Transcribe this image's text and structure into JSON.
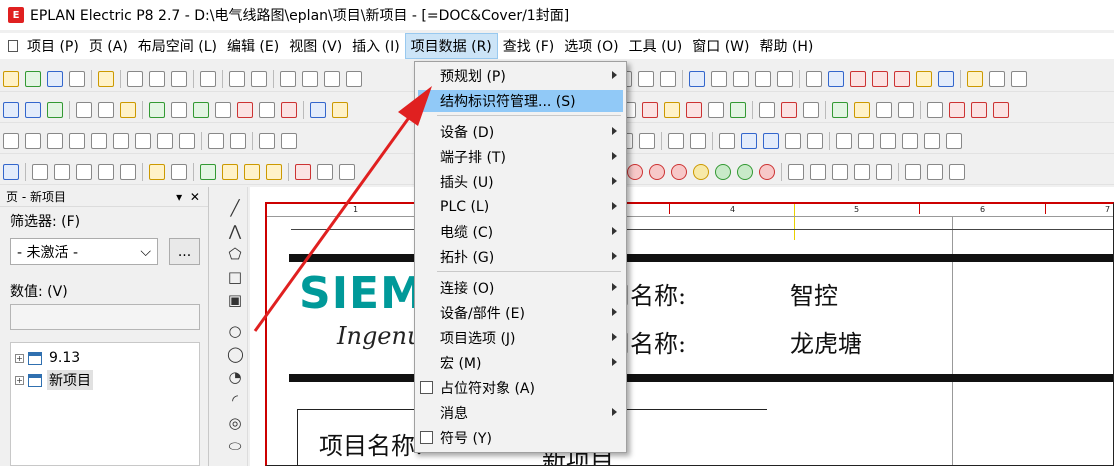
{
  "title": "EPLAN Electric P8 2.7 - D:\\电气线路图\\eplan\\项目\\新项目 - [=DOC&Cover/1封面]",
  "menubar": [
    "项目 (P)",
    "页 (A)",
    "布局空间 (L)",
    "编辑 (E)",
    "视图 (V)",
    "插入 (I)",
    "项目数据 (R)",
    "查找 (F)",
    "选项 (O)",
    "工具 (U)",
    "窗口 (W)",
    "帮助 (H)"
  ],
  "dropdown": [
    {
      "label": "预规划 (P)",
      "submenu": true
    },
    {
      "label": "结构标识符管理... (S)",
      "highlighted": true
    },
    {
      "label": "设备 (D)",
      "submenu": true
    },
    {
      "label": "端子排 (T)",
      "submenu": true
    },
    {
      "label": "插头 (U)",
      "submenu": true
    },
    {
      "label": "PLC (L)",
      "submenu": true
    },
    {
      "label": "电缆 (C)",
      "submenu": true
    },
    {
      "label": "拓扑 (G)",
      "submenu": true
    },
    {
      "label": "连接 (O)",
      "submenu": true
    },
    {
      "label": "设备/部件 (E)",
      "submenu": true
    },
    {
      "label": "项目选项 (J)",
      "submenu": true
    },
    {
      "label": "宏 (M)",
      "submenu": true
    },
    {
      "label": "占位符对象 (A)",
      "icon": "placeholder-object-icon"
    },
    {
      "label": "消息",
      "submenu": true
    },
    {
      "label": "符号 (Y)",
      "icon": "symbol-icon"
    }
  ],
  "left_panel": {
    "title": "页 - 新项目",
    "controls": "▾ ✕",
    "filter_label": "筛选器: (F)",
    "filter_value": "- 未激活 -",
    "filter_button": "...",
    "value_label": "数值: (V)",
    "tree": [
      {
        "label": "9.13",
        "expander": "+"
      },
      {
        "label": "新项目",
        "expander": "+",
        "selected": true
      }
    ]
  },
  "drawing": {
    "ruler": [
      "1",
      "4",
      "5",
      "6",
      "7"
    ],
    "logo_text": "SIEMENS",
    "tagline": "Ingenuity for life",
    "field1_label": "公司名称:",
    "field1_value": "智控",
    "field2_label": "公司名称:",
    "field2_value": "龙虎塘",
    "field3_label": "项目名称:",
    "field3_value": "新项目"
  },
  "colors": {
    "highlight": "#91c9f7",
    "brand": "#009999",
    "annotation_arrow": "#e02020"
  }
}
